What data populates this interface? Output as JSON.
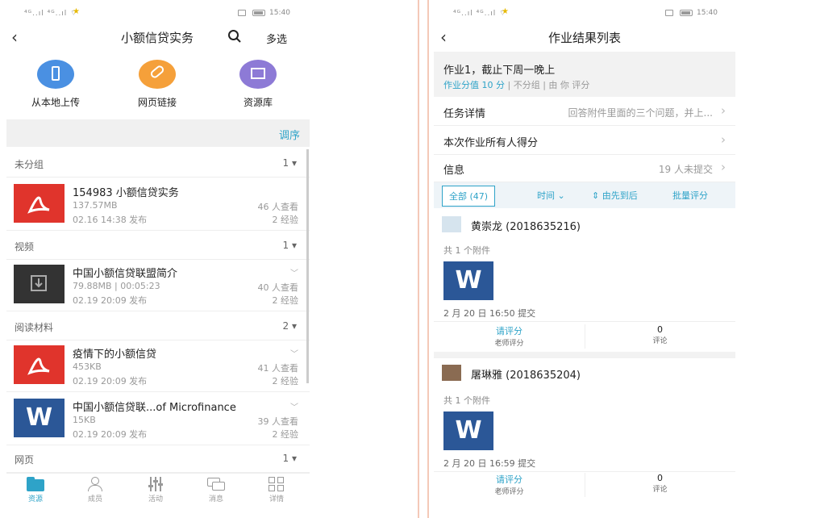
{
  "left": {
    "status": {
      "signal": "⁴ᴳ..ıl ⁴ᴳ..ıl ⌔",
      "time": "15:40"
    },
    "nav": {
      "title": "小额信贷实务",
      "multi_select": "多选"
    },
    "uploads": [
      {
        "label": "从本地上传",
        "color": "#4a90e2"
      },
      {
        "label": "网页链接",
        "color": "#f5a03a"
      },
      {
        "label": "资源库",
        "color": "#8d7ad6"
      }
    ],
    "sort_label": "调序",
    "groups": [
      {
        "name": "未分组",
        "count": "1"
      },
      {
        "name": "视频",
        "count": "1"
      },
      {
        "name": "阅读材料",
        "count": "2"
      },
      {
        "name": "网页",
        "count": "1"
      }
    ],
    "items": [
      {
        "title": "154983 小额信贷实务",
        "meta1": "137.57MB",
        "meta2": "02.16 14:38 发布",
        "views": "46 人查看",
        "exp": "2 经验"
      },
      {
        "title": "中国小额信贷联盟简介",
        "meta1": "79.88MB | 00:05:23",
        "meta2": "02.19 20:09 发布",
        "views": "40 人查看",
        "exp": "2 经验"
      },
      {
        "title": "疫情下的小额信贷",
        "meta1": "453KB",
        "meta2": "02.19 20:09 发布",
        "views": "41 人查看",
        "exp": "2 经验"
      },
      {
        "title": "中国小额信贷联...of Microfinance",
        "meta1": "15KB",
        "meta2": "02.19 20:09 发布",
        "views": "39 人查看",
        "exp": "2 经验"
      }
    ],
    "word_letter": "W",
    "tabs": [
      {
        "label": "资源",
        "icon": "folder-icon"
      },
      {
        "label": "成员",
        "icon": "person-icon"
      },
      {
        "label": "活动",
        "icon": "sliders-icon"
      },
      {
        "label": "消息",
        "icon": "chat-icon"
      },
      {
        "label": "详情",
        "icon": "grid-icon"
      }
    ]
  },
  "right": {
    "status": {
      "signal": "⁴ᴳ..ıl ⁴ᴳ..ıl ⌔",
      "time": "15:40"
    },
    "nav": {
      "title": "作业结果列表"
    },
    "header": {
      "title": "作业1，截止下周一晚上",
      "score": "作业分值 10 分",
      "sep1": " | ",
      "group": "不分组",
      "sep2": " | ",
      "grader": "由 你 评分"
    },
    "rows": [
      {
        "key": "任务详情",
        "value": "回答附件里面的三个问题，并上..."
      },
      {
        "key": "本次作业所有人得分",
        "value": ""
      },
      {
        "key": "信息",
        "value": "19 人未提交"
      }
    ],
    "filters": {
      "all": "全部 (47)",
      "time": "时间 ⌄",
      "order": "⇕ 由先到后",
      "batch": "批量评分"
    },
    "submissions": [
      {
        "name": "黄崇龙 (2018635216)",
        "attach": "共 1 个附件",
        "time": "2 月 20 日 16:50 提交",
        "grade": "请评分",
        "grade_sub": "老师评分",
        "comments": "0",
        "comments_sub": "评论"
      },
      {
        "name": "屠琳雅 (2018635204)",
        "attach": "共 1 个附件",
        "time": "2 月 20 日 16:59 提交",
        "grade": "请评分",
        "grade_sub": "老师评分",
        "comments": "0",
        "comments_sub": "评论"
      }
    ],
    "word_letter": "W"
  },
  "colors": {
    "accent": "#2ea3c8",
    "pdf": "#e0342c",
    "word": "#2b5797"
  }
}
